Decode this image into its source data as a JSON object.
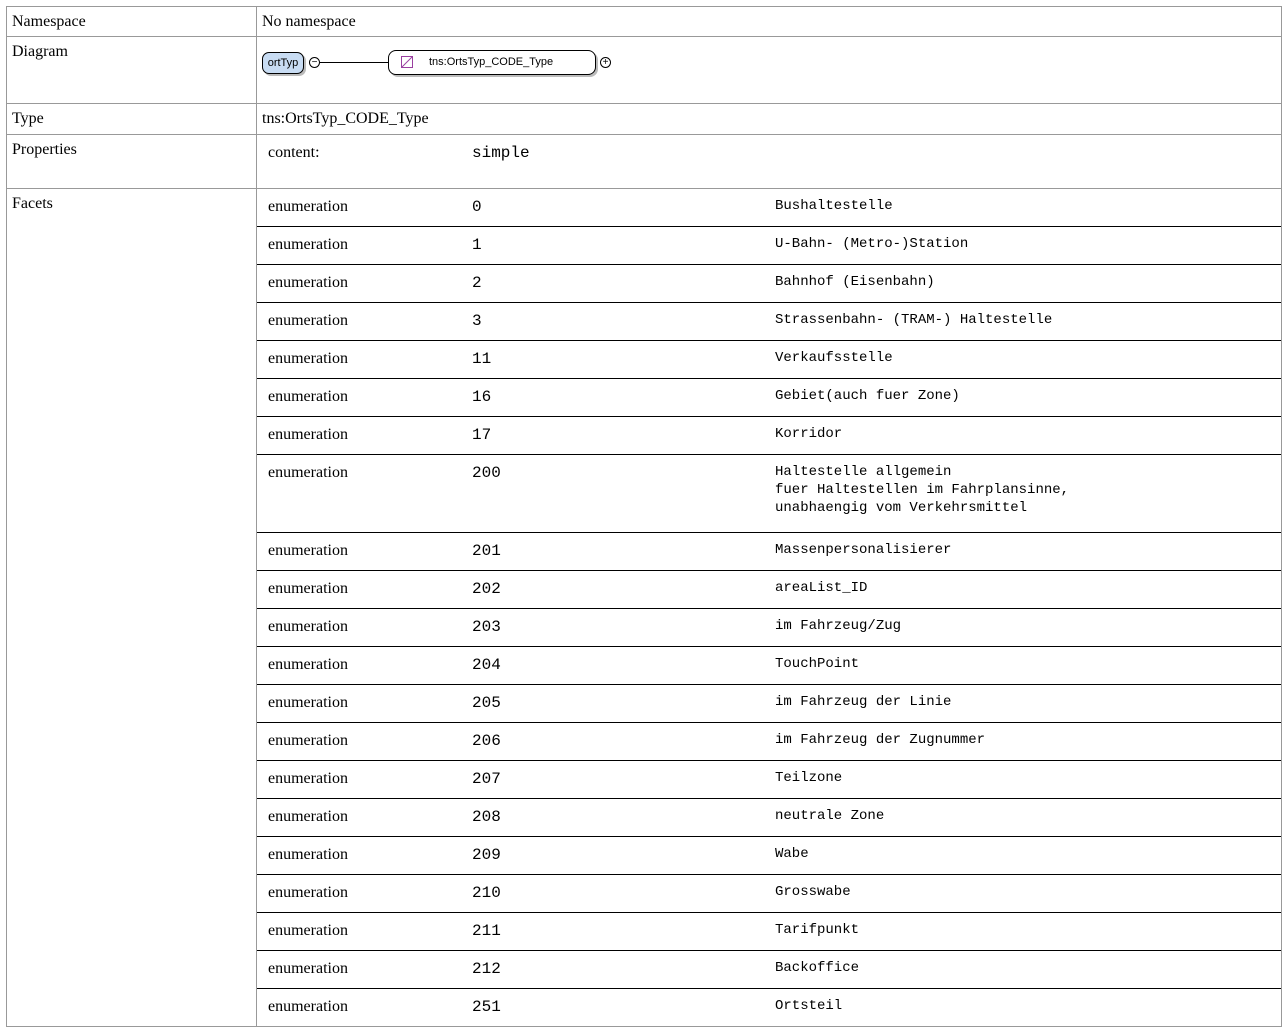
{
  "labels": {
    "namespace": "Namespace",
    "diagram": "Diagram",
    "type": "Type",
    "properties": "Properties",
    "facets": "Facets"
  },
  "namespace_value": "No namespace",
  "diagram": {
    "element_name": "ortTyp",
    "type_name": "tns:OrtsTyp_CODE_Type",
    "collapse_symbol": "−",
    "expand_symbol": "+"
  },
  "type_value": "tns:OrtsTyp_CODE_Type",
  "properties": {
    "key": "content:",
    "value": "simple"
  },
  "facets": [
    {
      "kind": "enumeration",
      "value": "0",
      "doc": "Bushaltestelle"
    },
    {
      "kind": "enumeration",
      "value": "1",
      "doc": "U-Bahn- (Metro-)Station"
    },
    {
      "kind": "enumeration",
      "value": "2",
      "doc": "Bahnhof (Eisenbahn)"
    },
    {
      "kind": "enumeration",
      "value": "3",
      "doc": "Strassenbahn- (TRAM-) Haltestelle"
    },
    {
      "kind": "enumeration",
      "value": "11",
      "doc": "Verkaufsstelle"
    },
    {
      "kind": "enumeration",
      "value": "16",
      "doc": "Gebiet(auch fuer Zone)"
    },
    {
      "kind": "enumeration",
      "value": "17",
      "doc": "Korridor"
    },
    {
      "kind": "enumeration",
      "value": "200",
      "doc": "Haltestelle allgemein\nfuer Haltestellen im Fahrplansinne,\nunabhaengig vom Verkehrsmittel"
    },
    {
      "kind": "enumeration",
      "value": "201",
      "doc": "Massenpersonalisierer"
    },
    {
      "kind": "enumeration",
      "value": "202",
      "doc": "areaList_ID"
    },
    {
      "kind": "enumeration",
      "value": "203",
      "doc": "im Fahrzeug/Zug"
    },
    {
      "kind": "enumeration",
      "value": "204",
      "doc": "TouchPoint"
    },
    {
      "kind": "enumeration",
      "value": "205",
      "doc": "im Fahrzeug der Linie"
    },
    {
      "kind": "enumeration",
      "value": "206",
      "doc": "im Fahrzeug der Zugnummer"
    },
    {
      "kind": "enumeration",
      "value": "207",
      "doc": "Teilzone"
    },
    {
      "kind": "enumeration",
      "value": "208",
      "doc": "neutrale Zone"
    },
    {
      "kind": "enumeration",
      "value": "209",
      "doc": "Wabe"
    },
    {
      "kind": "enumeration",
      "value": "210",
      "doc": "Grosswabe"
    },
    {
      "kind": "enumeration",
      "value": "211",
      "doc": "Tarifpunkt"
    },
    {
      "kind": "enumeration",
      "value": "212",
      "doc": "Backoffice"
    },
    {
      "kind": "enumeration",
      "value": "251",
      "doc": "Ortsteil"
    }
  ]
}
